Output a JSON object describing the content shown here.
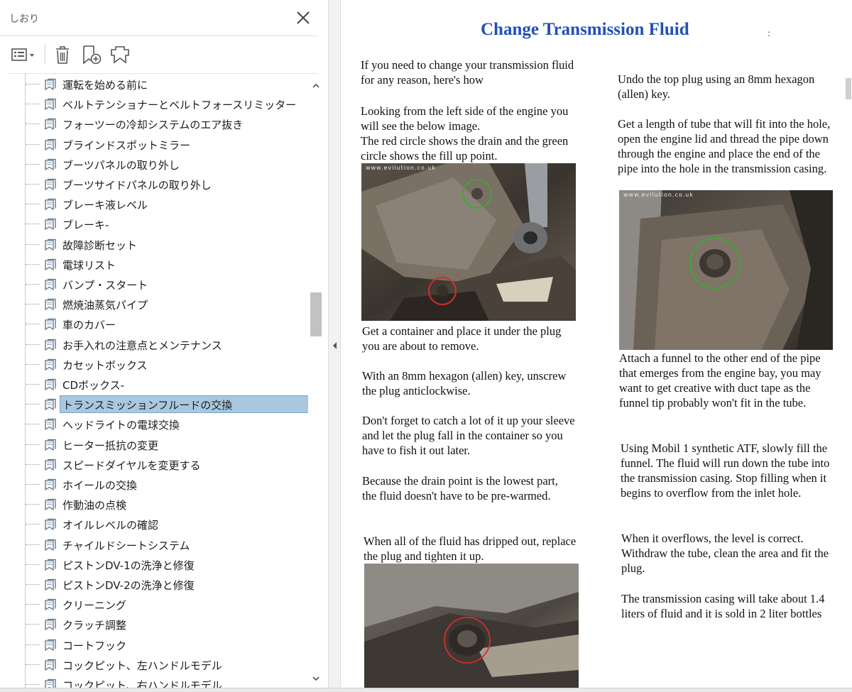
{
  "panel": {
    "title": "しおり",
    "toolbar": {
      "options": "options-menu-icon",
      "delete": "trash-icon",
      "new_bookmark": "new-bookmark-icon",
      "expand": "expand-bookmark-icon"
    },
    "bookmarks": [
      {
        "label": "運転を始める前に"
      },
      {
        "label": "ベルトテンショナーとベルトフォースリミッター"
      },
      {
        "label": "フォーツーの冷却システムのエア抜き"
      },
      {
        "label": "ブラインドスポットミラー"
      },
      {
        "label": "ブーツパネルの取り外し"
      },
      {
        "label": "ブーツサイドパネルの取り外し"
      },
      {
        "label": "ブレーキ液レベル"
      },
      {
        "label": "ブレーキ-"
      },
      {
        "label": "故障診断セット"
      },
      {
        "label": "電球リスト"
      },
      {
        "label": "バンプ・スタート"
      },
      {
        "label": "燃焼油蒸気パイプ"
      },
      {
        "label": "車のカバー"
      },
      {
        "label": "お手入れの注意点とメンテナンス"
      },
      {
        "label": "カセットボックス"
      },
      {
        "label": "CDボックス-"
      },
      {
        "label": "トランスミッションフルードの交換",
        "selected": true
      },
      {
        "label": "ヘッドライトの電球交換"
      },
      {
        "label": "ヒーター抵抗の変更"
      },
      {
        "label": "スピードダイヤルを変更する"
      },
      {
        "label": "ホイールの交換"
      },
      {
        "label": "作動油の点検"
      },
      {
        "label": "オイルレベルの確認"
      },
      {
        "label": "チャイルドシートシステム"
      },
      {
        "label": "ピストンDV-1の洗浄と修復"
      },
      {
        "label": "ピストンDV-2の洗浄と修復"
      },
      {
        "label": "クリーニング"
      },
      {
        "label": "クラッチ調整"
      },
      {
        "label": "コートフック"
      },
      {
        "label": "コックピット、左ハンドルモデル"
      },
      {
        "label": "コックピット、右ハンドルモデル"
      }
    ]
  },
  "document": {
    "title": "Change Transmission Fluid",
    "speck": ":",
    "watermark": "www.evilution.co.uk",
    "left_paragraphs": [
      "If you need to change your transmission fluid for any reason, here's how",
      "Looking from the left side of the engine you will see the below image.\nThe red circle shows the drain and the green circle shows the fill up point.",
      "Get a container and place it under the plug you are about to remove.",
      "With an 8mm hexagon (allen) key, unscrew the plug anticlockwise.",
      "Don't forget to catch a lot of it up your sleeve and let the plug fall in the container so you have to fish it out later.",
      "Because the drain point is the lowest part, the fluid doesn't have to be pre-warmed.",
      "When all of the fluid has dripped out, replace the plug and tighten it up."
    ],
    "right_paragraphs": [
      "Undo the top plug using an 8mm hexagon (allen) key.",
      "Get a length of tube that will fit into the hole, open the engine lid and thread the pipe down through the engine and place the end of the pipe into the hole in the transmission casing.",
      "Attach a funnel to the other end of the pipe that emerges from the engine bay, you may want to get creative with duct tape as the funnel tip probably won't fit in the tube.",
      "Using Mobil 1 synthetic ATF, slowly fill the funnel. The fluid will run down the tube into the transmission casing. Stop filling when it begins to overflow from the inlet hole.",
      "When it overflows, the level is correct. Withdraw the tube, clean the area and fit the plug.",
      "The transmission casing will take about 1.4 liters of fluid and it is sold in 2 liter bottles"
    ],
    "colors": {
      "title": "#2350b7",
      "drain_circle": "#d0302a",
      "fill_circle": "#3ea836"
    }
  }
}
